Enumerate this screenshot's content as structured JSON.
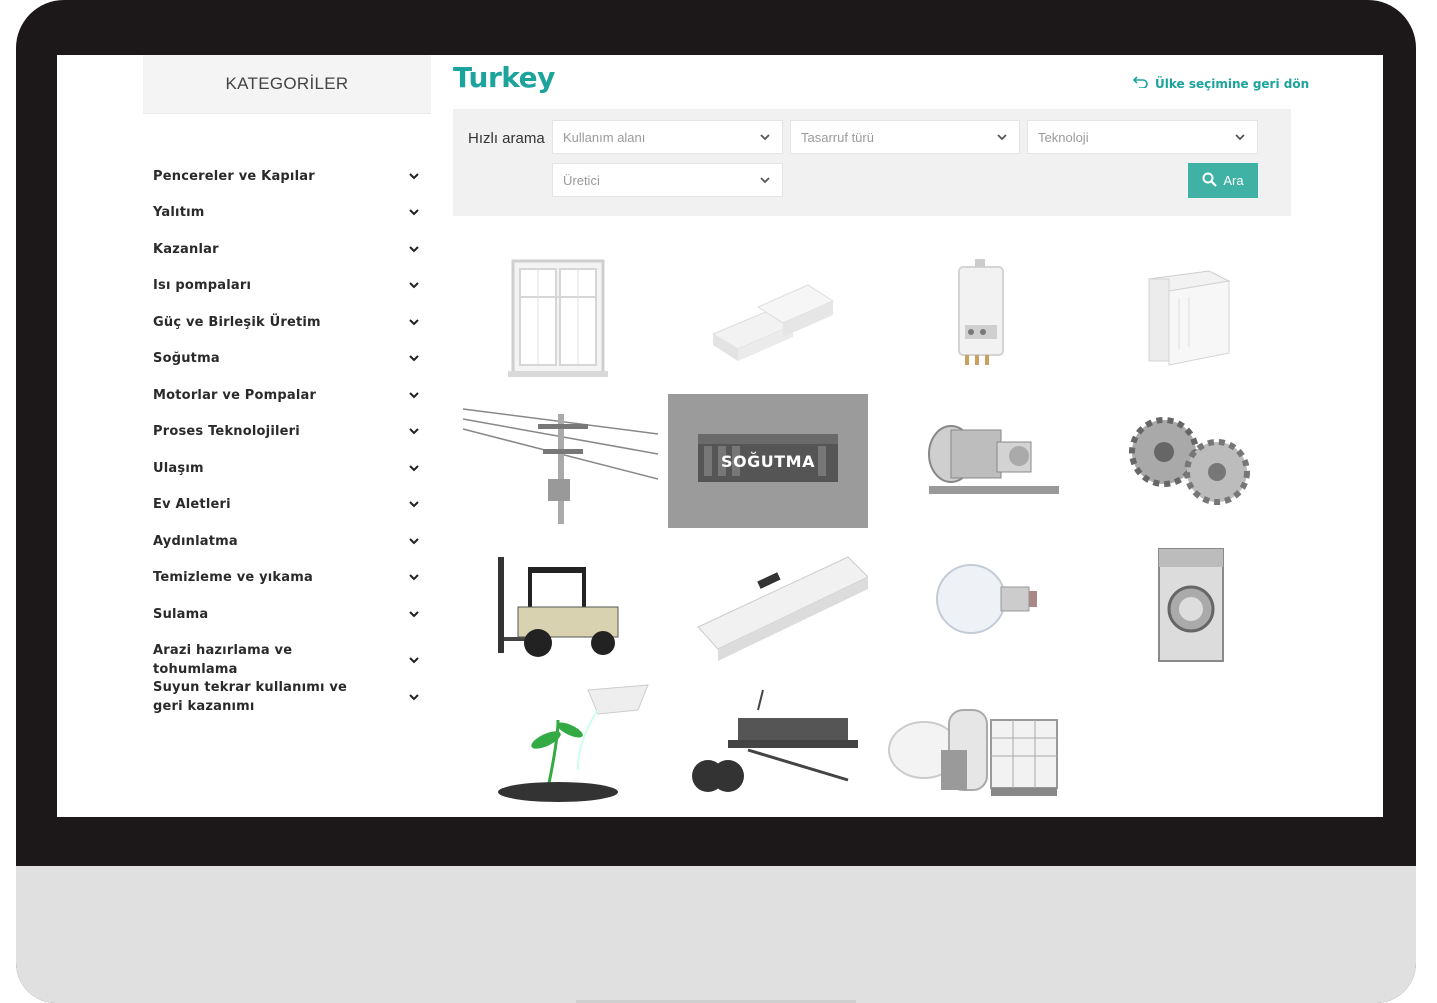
{
  "sidebar": {
    "header": "KATEGORİLER",
    "items": [
      {
        "label": "Pencereler ve Kapılar"
      },
      {
        "label": "Yalıtım"
      },
      {
        "label": "Kazanlar"
      },
      {
        "label": "Isı pompaları"
      },
      {
        "label": "Güç ve Birleşik Üretim"
      },
      {
        "label": "Soğutma"
      },
      {
        "label": "Motorlar ve Pompalar"
      },
      {
        "label": "Proses Teknolojileri"
      },
      {
        "label": "Ulaşım"
      },
      {
        "label": "Ev Aletleri"
      },
      {
        "label": "Aydınlatma"
      },
      {
        "label": "Temizleme ve yıkama"
      },
      {
        "label": "Sulama"
      },
      {
        "label": "Arazi hazırlama ve tohumlama"
      },
      {
        "label": "Suyun tekrar kullanımı ve geri kazanımı"
      }
    ]
  },
  "header": {
    "title": "Turkey",
    "back_link": "Ülke seçimine geri dön"
  },
  "search": {
    "label": "Hızlı arama",
    "filters": {
      "usage": "Kullanım alanı",
      "saving": "Tasarruf türü",
      "technology": "Teknoloji",
      "manufacturer": "Üretici"
    },
    "button": "Ara"
  },
  "grid": {
    "hover_label": "SOĞUTMA",
    "tiles": [
      {
        "icon": "window-icon"
      },
      {
        "icon": "insulation-icon"
      },
      {
        "icon": "boiler-icon"
      },
      {
        "icon": "heat-pump-icon"
      },
      {
        "icon": "power-line-icon"
      },
      {
        "icon": "cooling-icon"
      },
      {
        "icon": "motor-pump-icon"
      },
      {
        "icon": "gears-icon"
      },
      {
        "icon": "forklift-icon"
      },
      {
        "icon": "air-conditioner-icon"
      },
      {
        "icon": "light-bulb-icon"
      },
      {
        "icon": "washing-machine-icon"
      },
      {
        "icon": "irrigation-icon"
      },
      {
        "icon": "seeder-icon"
      },
      {
        "icon": "water-tank-icon"
      }
    ]
  },
  "colors": {
    "accent": "#1ba39c",
    "button": "#3fb1a5",
    "bezel": "#1c1718",
    "stand": "#e0e0e0"
  }
}
